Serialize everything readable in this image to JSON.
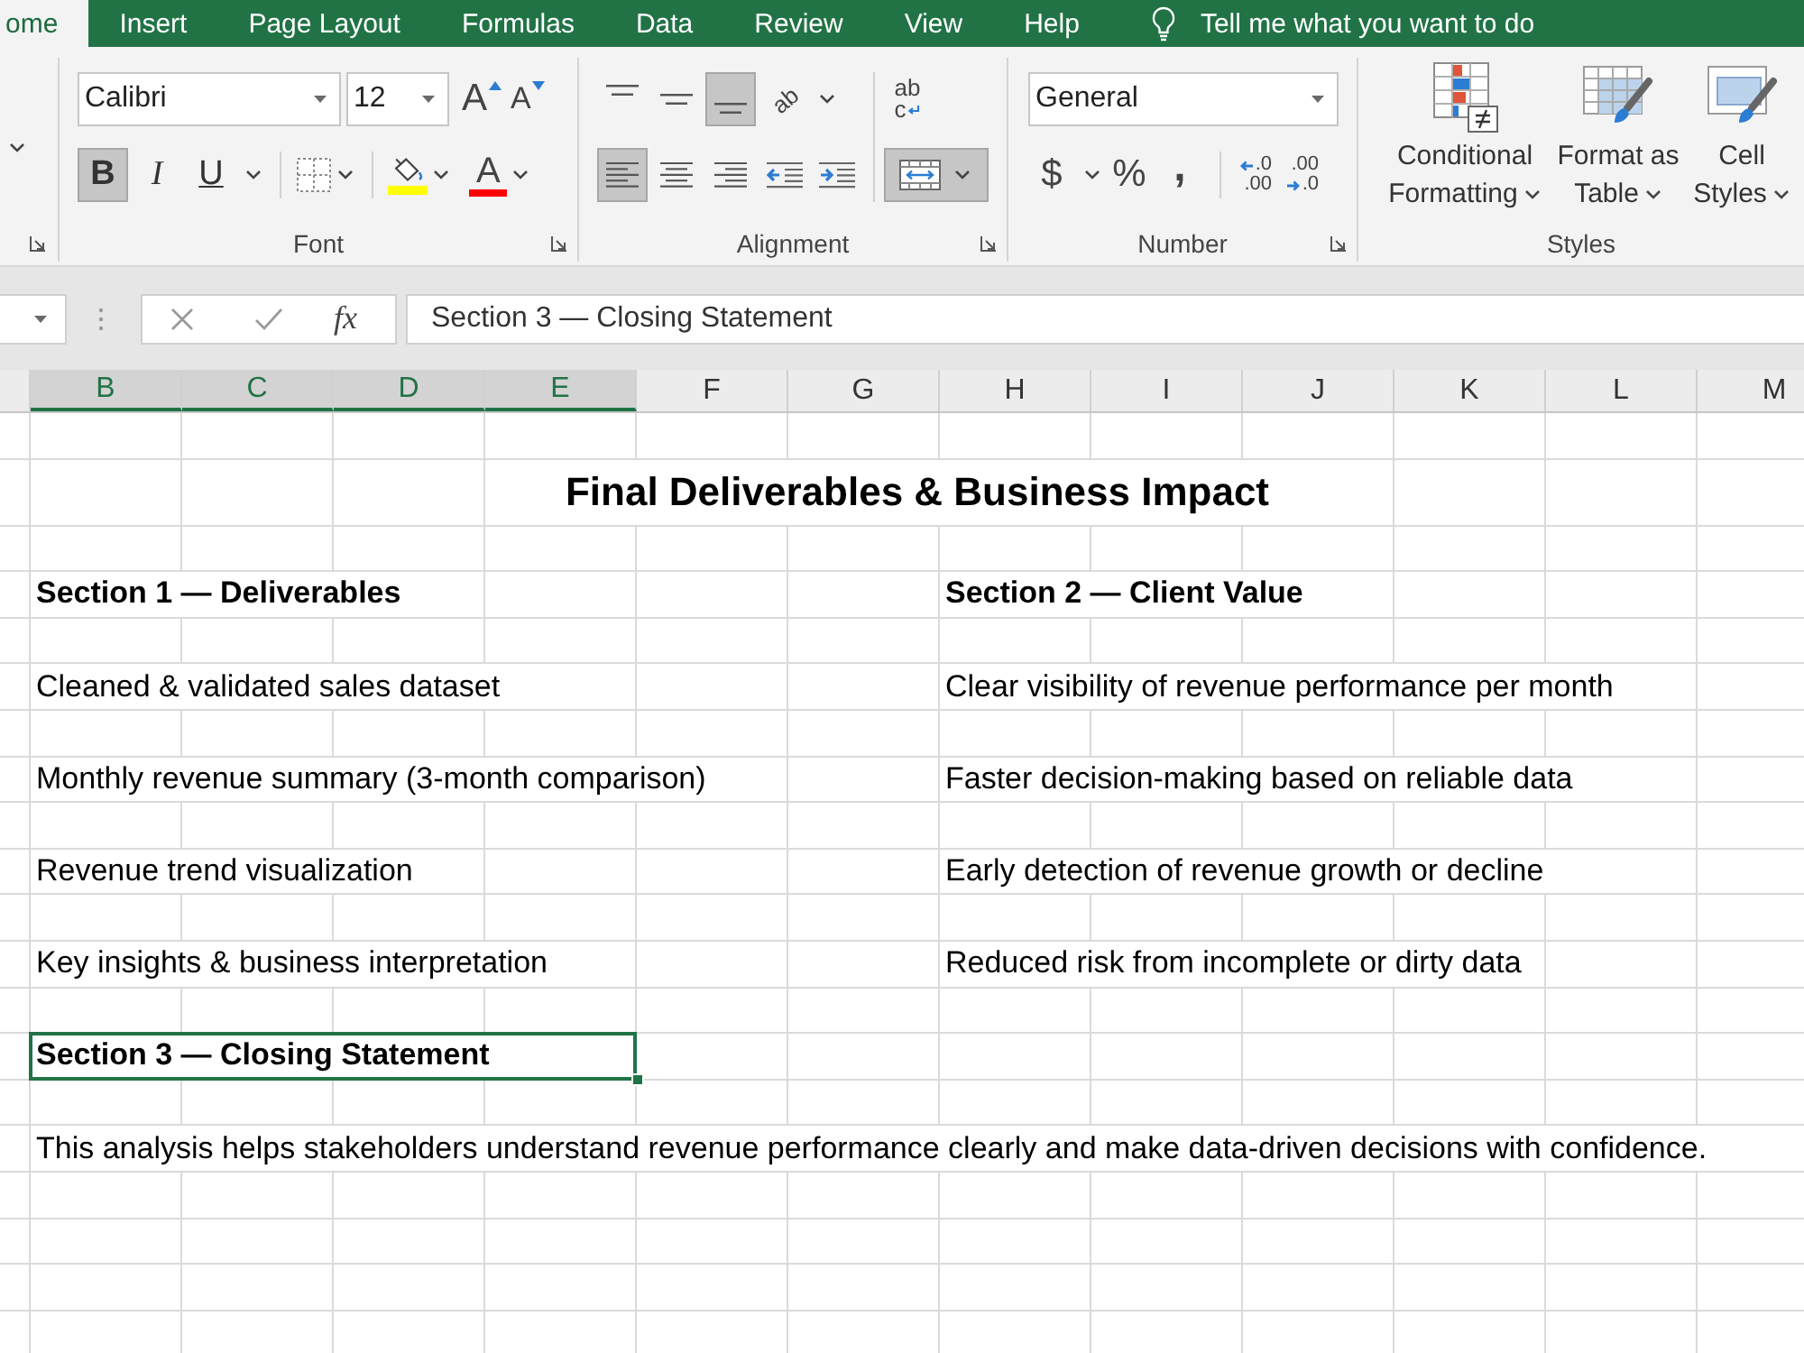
{
  "ribbon_tabs": [
    {
      "label": "ome",
      "selected": true
    },
    {
      "label": "Insert",
      "selected": false
    },
    {
      "label": "Page Layout",
      "selected": false
    },
    {
      "label": "Formulas",
      "selected": false
    },
    {
      "label": "Data",
      "selected": false
    },
    {
      "label": "Review",
      "selected": false
    },
    {
      "label": "View",
      "selected": false
    },
    {
      "label": "Help",
      "selected": false
    }
  ],
  "tell_me": {
    "label": "Tell me what you want to do"
  },
  "ribbon": {
    "font": {
      "label": "Font",
      "name": "Calibri",
      "size": "12",
      "grow_glyph": "A",
      "shrink_glyph": "A",
      "styles": [
        {
          "kind": "bold",
          "glyph": "B",
          "on": true
        },
        {
          "kind": "italic",
          "glyph": "I",
          "on": false
        },
        {
          "kind": "underline",
          "glyph": "U",
          "on": false
        }
      ],
      "color_glyph": "A"
    },
    "alignment": {
      "label": "Alignment",
      "vertical": [
        {
          "kind": "top",
          "selected": false
        },
        {
          "kind": "middle",
          "selected": false
        },
        {
          "kind": "bottom",
          "selected": true
        }
      ],
      "orientation_glyph": "ab",
      "wrap_glyphs": [
        "ab",
        "c"
      ],
      "horizontal": [
        {
          "kind": "left",
          "selected": true
        },
        {
          "kind": "center",
          "selected": false
        },
        {
          "kind": "right",
          "selected": false
        }
      ],
      "merge": {
        "on": true
      }
    },
    "number": {
      "label": "Number",
      "format": "General",
      "currency_glyph": "$",
      "percent_glyph": "%",
      "comma_glyph": ",",
      "increase_decimal": [
        ".0",
        ".00"
      ],
      "decrease_decimal": [
        ".00",
        ".0"
      ]
    },
    "styles": {
      "label": "Styles",
      "buttons": [
        {
          "kind": "conditional_formatting",
          "lines": [
            "Conditional",
            "Formatting"
          ]
        },
        {
          "kind": "format_as_table",
          "lines": [
            "Format as",
            "Table"
          ]
        },
        {
          "kind": "cell_styles",
          "lines": [
            "Cell",
            "Styles"
          ]
        }
      ]
    }
  },
  "formula_bar": {
    "function_glyph": "fx",
    "formula": "Section 3 — Closing Statement"
  },
  "sheet": {
    "columns": [
      {
        "label": "B",
        "selected": true
      },
      {
        "label": "C",
        "selected": true
      },
      {
        "label": "D",
        "selected": true
      },
      {
        "label": "E",
        "selected": true
      },
      {
        "label": "F",
        "selected": false
      },
      {
        "label": "G",
        "selected": false
      },
      {
        "label": "H",
        "selected": false
      },
      {
        "label": "I",
        "selected": false
      },
      {
        "label": "J",
        "selected": false
      },
      {
        "label": "K",
        "selected": false
      },
      {
        "label": "L",
        "selected": false
      },
      {
        "label": "M",
        "selected": false
      }
    ],
    "rows": [
      {},
      {
        "B": {
          "kind": "title",
          "text": "Final Deliverables & Business Impact",
          "selected": false
        }
      },
      {},
      {
        "B": {
          "kind": "heading",
          "text": "Section 1 — Deliverables",
          "selected": false
        },
        "H": {
          "kind": "heading",
          "text": "Section 2 — Client Value",
          "selected": false
        }
      },
      {},
      {
        "B": {
          "kind": "text",
          "text": "Cleaned & validated sales dataset",
          "selected": false
        },
        "H": {
          "kind": "text",
          "text": "Clear visibility of revenue performance per month",
          "selected": false
        }
      },
      {},
      {
        "B": {
          "kind": "text",
          "text": "Monthly revenue summary (3-month comparison)",
          "selected": false
        },
        "H": {
          "kind": "text",
          "text": "Faster decision-making based on reliable data",
          "selected": false
        }
      },
      {},
      {
        "B": {
          "kind": "text",
          "text": "Revenue trend visualization",
          "selected": false
        },
        "H": {
          "kind": "text",
          "text": "Early detection of revenue growth or decline",
          "selected": false
        }
      },
      {},
      {
        "B": {
          "kind": "text",
          "text": "Key insights & business interpretation",
          "selected": false
        },
        "H": {
          "kind": "text",
          "text": "Reduced risk from incomplete or dirty data",
          "selected": false
        }
      },
      {},
      {
        "B": {
          "kind": "heading",
          "text": "Section 3 — Closing Statement",
          "selected": true
        }
      },
      {},
      {
        "B": {
          "kind": "text",
          "text": "This analysis helps stakeholders understand revenue performance clearly and make data-driven decisions with confidence.",
          "selected": false
        }
      },
      {},
      {},
      {},
      {}
    ]
  }
}
